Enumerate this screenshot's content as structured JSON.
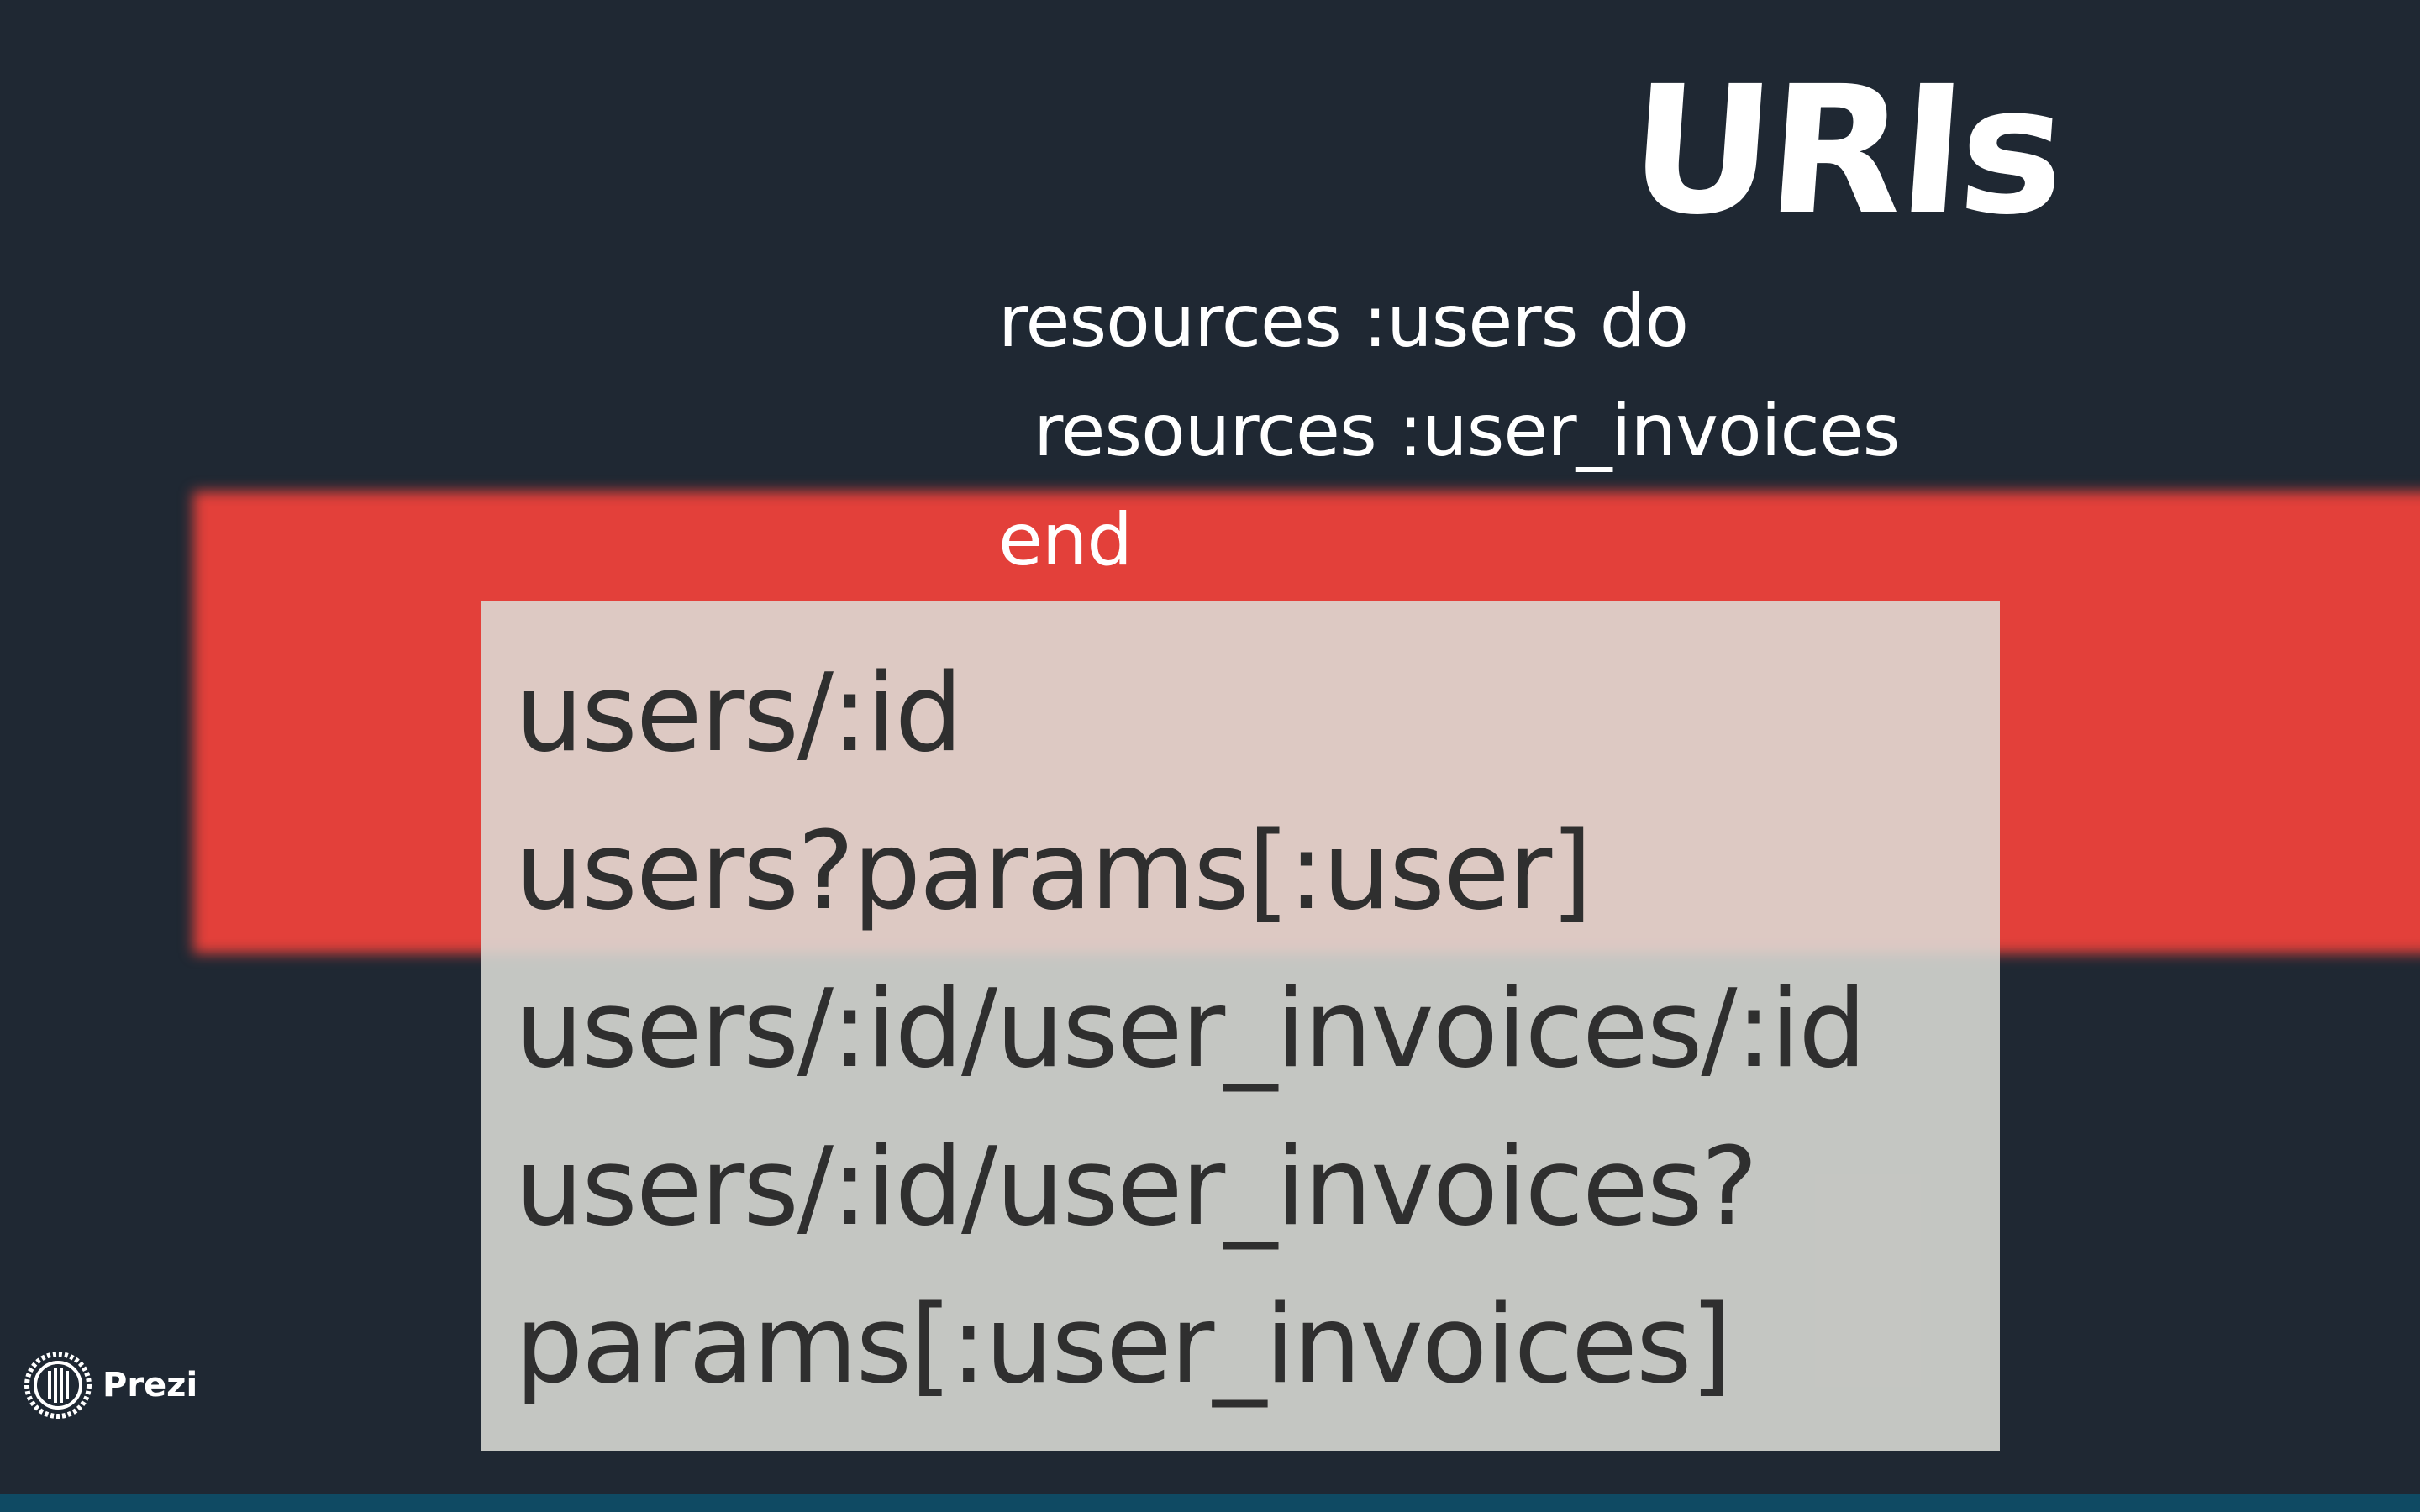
{
  "slide": {
    "title": "URIs",
    "code_lines": [
      "resources :users do",
      "resources :user_invoices",
      "end"
    ],
    "uris": [
      "users/:id",
      "users?params[:user]",
      "users/:id/user_invoices/:id",
      "users/:id/user_invoices?",
      "params[:user_invoices]"
    ]
  },
  "branding": {
    "logo_text": "Prezi",
    "logo_icon": "prezi-icon"
  },
  "colors": {
    "background": "#1f2833",
    "accent_red": "#e3403a",
    "box_fill": "#dcdcd6",
    "uri_text": "#2f2f2f",
    "title_text": "#ffffff"
  }
}
